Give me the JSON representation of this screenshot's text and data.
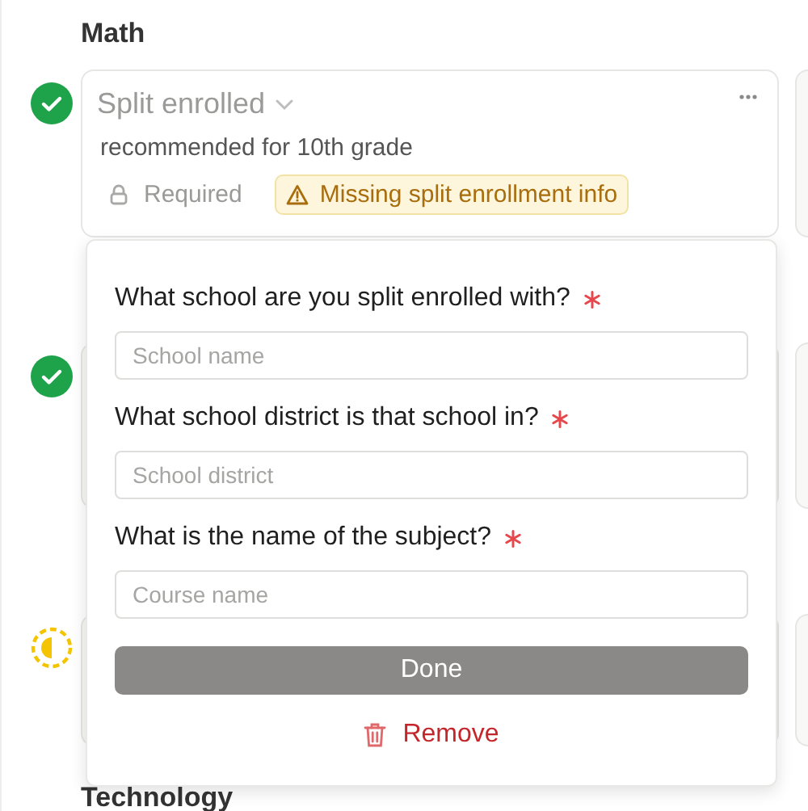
{
  "section": {
    "title": "Math"
  },
  "courses": [
    {
      "kind": "complete",
      "title": "Split enrolled",
      "note": "recommended for 10th grade",
      "requirement": "Required",
      "warning": "Missing split enrollment info"
    },
    {
      "kind": "complete"
    },
    {
      "kind": "partial"
    }
  ],
  "popover": {
    "questions": [
      {
        "label": "What school are you split enrolled with?",
        "required": true,
        "placeholder": "School name"
      },
      {
        "label": "What school district is that school in?",
        "required": true,
        "placeholder": "School district"
      },
      {
        "label": "What is the name of the subject?",
        "required": true,
        "placeholder": "Course name"
      }
    ],
    "done": "Done",
    "remove": "Remove"
  },
  "next_section": {
    "title": "Technology"
  }
}
